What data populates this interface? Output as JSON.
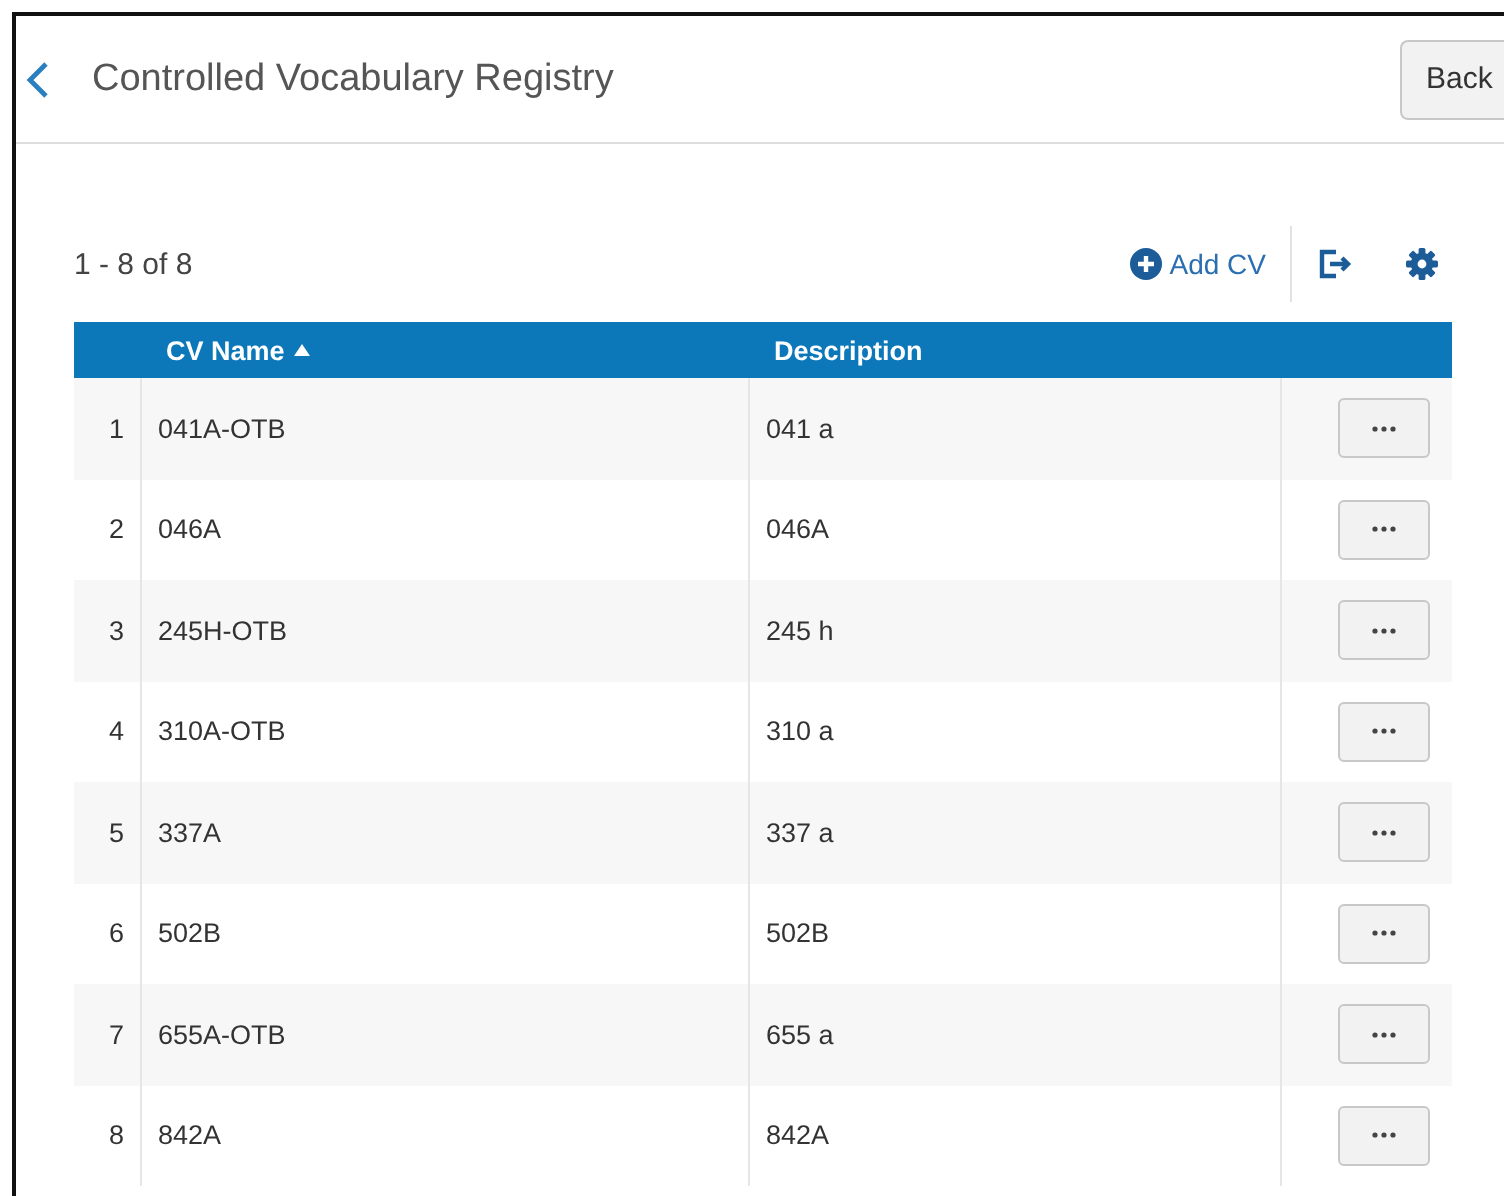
{
  "header": {
    "title": "Controlled Vocabulary Registry",
    "back_button": "Back"
  },
  "toolbar": {
    "count": "1 - 8 of 8",
    "add_button": "Add CV"
  },
  "table": {
    "columns": [
      {
        "label": "CV Name",
        "sorted": true
      },
      {
        "label": "Description",
        "sorted": false
      }
    ],
    "rows": [
      {
        "number": "1",
        "name": "041A-OTB",
        "description": "041 a"
      },
      {
        "number": "2",
        "name": "046A",
        "description": "046A"
      },
      {
        "number": "3",
        "name": "245H-OTB",
        "description": "245 h"
      },
      {
        "number": "4",
        "name": "310A-OTB",
        "description": "310 a"
      },
      {
        "number": "5",
        "name": "337A",
        "description": "337 a"
      },
      {
        "number": "6",
        "name": "502B",
        "description": "502B"
      },
      {
        "number": "7",
        "name": "655A-OTB",
        "description": "655 a"
      },
      {
        "number": "8",
        "name": "842A",
        "description": "842A"
      }
    ]
  }
}
